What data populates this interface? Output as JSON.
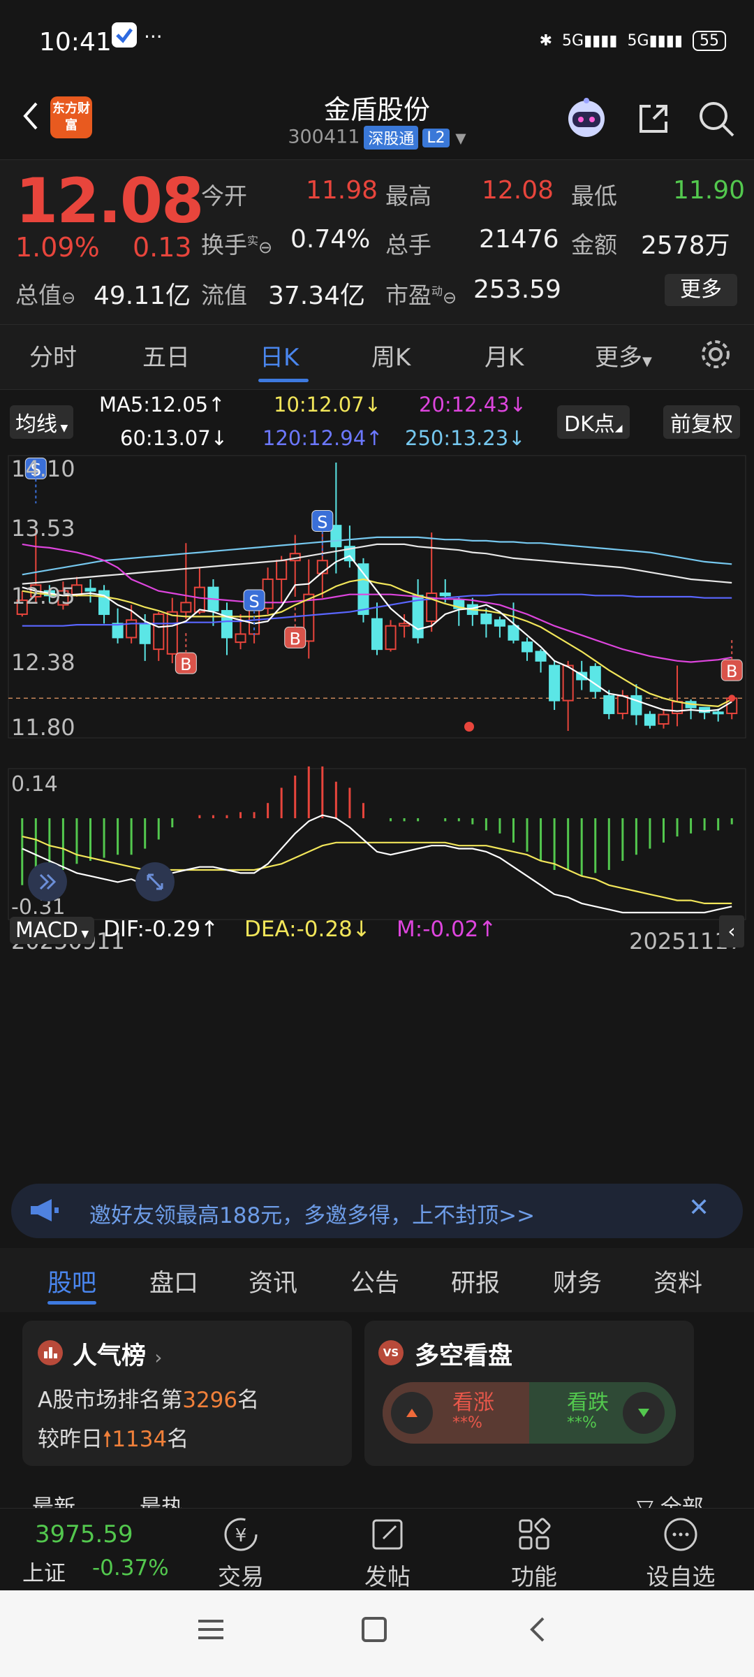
{
  "status": {
    "time": "10:41",
    "signal1": "5G",
    "signal2": "5G",
    "battery": "55",
    "more": "···"
  },
  "header": {
    "name": "金盾股份",
    "code": "300411",
    "tag1": "深股通",
    "tag2": "L2",
    "logo": "东方财富"
  },
  "quote": {
    "price": "12.08",
    "change_pct": "1.09%",
    "change": "0.13",
    "open_label": "今开",
    "open": "11.98",
    "high_label": "最高",
    "high": "12.08",
    "low_label": "最低",
    "low": "11.90",
    "turnover_label": "换手",
    "turnover_sup": "实",
    "turnover": "0.74%",
    "volume_label": "总手",
    "volume": "21476",
    "amount_label": "金额",
    "amount": "2578万",
    "mcap_label": "总值",
    "mcap": "49.11亿",
    "float_label": "流值",
    "float_mcap": "37.34亿",
    "pe_label": "市盈",
    "pe_sup": "动",
    "pe": "253.59",
    "more": "更多"
  },
  "tabs": [
    "分时",
    "五日",
    "日K",
    "周K",
    "月K",
    "更多"
  ],
  "active_tab": "日K",
  "ma": {
    "selector": "均线",
    "ma5": "MA5:12.05",
    "ma10": "10:12.07",
    "ma20": "20:12.43",
    "ma60": "60:13.07",
    "ma120": "120:12.94",
    "ma250": "250:13.23",
    "dk": "DK点",
    "adjust": "前复权",
    "colors": {
      "ma5": "#ffffff",
      "ma10": "#f2e65a",
      "ma20": "#de45de",
      "ma60": "#ffffff",
      "ma120": "#6c78ff",
      "ma250": "#76c8ef"
    }
  },
  "macd": {
    "selector": "MACD",
    "dif": "DIF:-0.29",
    "dea": "DEA:-0.28",
    "m": "M:-0.02",
    "top": "0.14",
    "bottom": "-0.31"
  },
  "chart_data": {
    "type": "candlestick",
    "y_ticks": [
      "14.10",
      "13.53",
      "12.95",
      "12.38",
      "11.80"
    ],
    "ylim": [
      11.8,
      14.1
    ],
    "x_start": "20250911",
    "x_end": "20251117",
    "candles": [
      [
        12.8,
        12.92,
        13.0,
        12.78
      ],
      [
        12.95,
        13.05,
        13.52,
        12.9
      ],
      [
        13.0,
        12.96,
        13.05,
        12.9
      ],
      [
        12.88,
        13.0,
        13.08,
        12.84
      ],
      [
        12.97,
        13.05,
        13.12,
        12.95
      ],
      [
        13.02,
        13.0,
        13.1,
        12.9
      ],
      [
        13.0,
        12.8,
        13.05,
        12.72
      ],
      [
        12.72,
        12.6,
        12.85,
        12.55
      ],
      [
        12.6,
        12.75,
        12.88,
        12.55
      ],
      [
        12.72,
        12.55,
        12.8,
        12.4
      ],
      [
        12.5,
        12.8,
        12.82,
        12.4
      ],
      [
        12.46,
        12.82,
        12.94,
        12.38
      ],
      [
        12.82,
        12.9,
        13.41,
        12.76
      ],
      [
        12.82,
        13.03,
        13.2,
        12.8
      ],
      [
        13.03,
        12.83,
        13.1,
        12.7
      ],
      [
        12.83,
        12.6,
        12.9,
        12.45
      ],
      [
        12.56,
        12.63,
        12.8,
        12.5
      ],
      [
        12.63,
        12.85,
        12.9,
        12.55
      ],
      [
        12.85,
        13.1,
        13.2,
        12.8
      ],
      [
        13.1,
        13.26,
        13.3,
        12.9
      ],
      [
        13.26,
        13.32,
        13.48,
        12.95
      ],
      [
        12.57,
        12.97,
        13.27,
        12.42
      ],
      [
        13.15,
        13.26,
        13.6,
        12.94
      ],
      [
        13.56,
        13.38,
        14.1,
        13.15
      ],
      [
        13.38,
        13.26,
        13.56,
        13.2
      ],
      [
        13.23,
        12.8,
        13.28,
        12.73
      ],
      [
        12.76,
        12.5,
        12.9,
        12.45
      ],
      [
        12.5,
        12.7,
        12.75,
        12.48
      ],
      [
        12.7,
        12.72,
        12.8,
        12.6
      ],
      [
        12.96,
        12.6,
        13.1,
        12.55
      ],
      [
        12.74,
        12.98,
        13.5,
        12.65
      ],
      [
        12.98,
        12.96,
        13.1,
        12.9
      ],
      [
        12.92,
        12.85,
        12.95,
        12.7
      ],
      [
        12.88,
        12.8,
        12.94,
        12.7
      ],
      [
        12.8,
        12.72,
        12.85,
        12.6
      ],
      [
        12.75,
        12.7,
        12.78,
        12.6
      ],
      [
        12.7,
        12.58,
        12.9,
        12.55
      ],
      [
        12.56,
        12.48,
        12.6,
        12.4
      ],
      [
        12.48,
        12.4,
        12.5,
        12.3
      ],
      [
        12.36,
        12.06,
        12.4,
        11.98
      ],
      [
        12.06,
        12.36,
        12.4,
        11.8
      ],
      [
        12.3,
        12.24,
        12.4,
        12.15
      ],
      [
        12.35,
        12.14,
        12.38,
        12.08
      ],
      [
        12.1,
        11.95,
        12.15,
        11.9
      ],
      [
        11.95,
        12.1,
        12.15,
        11.9
      ],
      [
        12.1,
        11.94,
        12.2,
        11.85
      ],
      [
        11.94,
        11.85,
        11.97,
        11.82
      ],
      [
        11.86,
        11.94,
        11.99,
        11.82
      ],
      [
        11.95,
        12.05,
        12.36,
        11.84
      ],
      [
        12.05,
        12.0,
        12.07,
        11.9
      ],
      [
        12.0,
        11.96,
        12.0,
        11.9
      ],
      [
        11.96,
        11.95,
        11.99,
        11.88
      ],
      [
        11.95,
        12.08,
        12.08,
        11.9
      ]
    ],
    "ma5": [
      13.03,
      13.0,
      12.98,
      12.96,
      12.97,
      12.98,
      12.96,
      12.88,
      12.83,
      12.74,
      12.69,
      12.7,
      12.74,
      12.84,
      12.82,
      12.78,
      12.75,
      12.72,
      12.74,
      12.87,
      13.05,
      13.06,
      13.16,
      13.25,
      13.3,
      13.15,
      13.0,
      12.85,
      12.75,
      12.67,
      12.7,
      12.8,
      12.84,
      12.85,
      12.88,
      12.82,
      12.72,
      12.62,
      12.52,
      12.4,
      12.35,
      12.28,
      12.2,
      12.12,
      12.1,
      12.06,
      12.02,
      11.98,
      11.97,
      11.98,
      11.97,
      11.98,
      12.05
    ],
    "ma10": [
      13.0,
      12.98,
      12.97,
      12.96,
      12.96,
      12.96,
      12.95,
      12.93,
      12.9,
      12.86,
      12.83,
      12.79,
      12.78,
      12.78,
      12.78,
      12.78,
      12.78,
      12.78,
      12.79,
      12.82,
      12.88,
      12.93,
      12.98,
      13.04,
      13.08,
      13.1,
      13.07,
      13.05,
      13.0,
      12.96,
      12.93,
      12.89,
      12.86,
      12.84,
      12.83,
      12.81,
      12.78,
      12.74,
      12.69,
      12.62,
      12.55,
      12.48,
      12.4,
      12.32,
      12.25,
      12.18,
      12.12,
      12.08,
      12.05,
      12.03,
      12.02,
      12.01,
      12.07
    ],
    "ma20": [
      13.4,
      13.38,
      13.37,
      13.35,
      13.33,
      13.3,
      13.26,
      13.2,
      13.1,
      13.05,
      13.0,
      12.98,
      12.96,
      12.94,
      12.93,
      12.92,
      12.91,
      12.9,
      12.9,
      12.9,
      12.91,
      12.92,
      12.93,
      12.95,
      12.97,
      12.97,
      12.97,
      12.97,
      12.96,
      12.95,
      12.94,
      12.93,
      12.93,
      12.92,
      12.9,
      12.88,
      12.84,
      12.8,
      12.75,
      12.7,
      12.66,
      12.62,
      12.58,
      12.54,
      12.5,
      12.47,
      12.44,
      12.42,
      12.4,
      12.39,
      12.4,
      12.41,
      12.43
    ],
    "ma60": [
      13.06,
      13.07,
      13.08,
      13.1,
      13.11,
      13.12,
      13.13,
      13.14,
      13.15,
      13.16,
      13.17,
      13.18,
      13.19,
      13.2,
      13.21,
      13.22,
      13.23,
      13.24,
      13.25,
      13.26,
      13.28,
      13.3,
      13.32,
      13.34,
      13.36,
      13.38,
      13.4,
      13.4,
      13.4,
      13.38,
      13.37,
      13.36,
      13.35,
      13.33,
      13.32,
      13.3,
      13.28,
      13.27,
      13.26,
      13.25,
      13.24,
      13.23,
      13.22,
      13.21,
      13.2,
      13.18,
      13.16,
      13.14,
      13.12,
      13.1,
      13.09,
      13.08,
      13.07
    ],
    "ma120": [
      12.7,
      12.7,
      12.7,
      12.7,
      12.71,
      12.71,
      12.71,
      12.71,
      12.72,
      12.72,
      12.72,
      12.72,
      12.73,
      12.73,
      12.73,
      12.74,
      12.74,
      12.75,
      12.76,
      12.77,
      12.78,
      12.79,
      12.8,
      12.81,
      12.82,
      12.84,
      12.86,
      12.88,
      12.9,
      12.92,
      12.93,
      12.94,
      12.95,
      12.96,
      12.96,
      12.97,
      12.97,
      12.97,
      12.97,
      12.97,
      12.97,
      12.97,
      12.96,
      12.96,
      12.96,
      12.95,
      12.95,
      12.95,
      12.95,
      12.95,
      12.94,
      12.94,
      12.94
    ],
    "ma250": [
      13.14,
      13.16,
      13.18,
      13.2,
      13.22,
      13.24,
      13.26,
      13.27,
      13.28,
      13.29,
      13.3,
      13.31,
      13.32,
      13.33,
      13.34,
      13.35,
      13.36,
      13.37,
      13.38,
      13.39,
      13.4,
      13.41,
      13.42,
      13.43,
      13.44,
      13.45,
      13.46,
      13.46,
      13.46,
      13.46,
      13.45,
      13.44,
      13.44,
      13.43,
      13.43,
      13.42,
      13.42,
      13.41,
      13.41,
      13.4,
      13.39,
      13.38,
      13.37,
      13.36,
      13.35,
      13.34,
      13.33,
      13.31,
      13.29,
      13.27,
      13.25,
      13.24,
      13.23
    ],
    "markers": [
      {
        "label": "S",
        "index": 1,
        "price": 14.05
      },
      {
        "label": "B",
        "index": 12,
        "price": 12.38
      },
      {
        "label": "S",
        "index": 17,
        "price": 12.92
      },
      {
        "label": "B",
        "index": 20,
        "price": 12.6
      },
      {
        "label": "S",
        "index": 22,
        "price": 13.6
      },
      {
        "label": "B",
        "index": 52,
        "price": 12.32
      }
    ],
    "last_price": 12.08,
    "macd_hist": [
      -0.22,
      -0.22,
      -0.2,
      -0.17,
      -0.15,
      -0.14,
      -0.13,
      -0.12,
      -0.12,
      -0.1,
      -0.07,
      -0.03,
      0.0,
      0.01,
      0.01,
      0.01,
      0.02,
      0.02,
      0.05,
      0.1,
      0.14,
      0.17,
      0.17,
      0.12,
      0.1,
      0.05,
      0.0,
      -0.01,
      -0.01,
      -0.01,
      0.0,
      -0.01,
      -0.01,
      -0.02,
      -0.04,
      -0.05,
      -0.08,
      -0.11,
      -0.14,
      -0.17,
      -0.17,
      -0.19,
      -0.18,
      -0.17,
      -0.14,
      -0.12,
      -0.1,
      -0.08,
      -0.06,
      -0.05,
      -0.04,
      -0.04,
      -0.02
    ],
    "dif": [
      -0.1,
      -0.12,
      -0.14,
      -0.16,
      -0.18,
      -0.19,
      -0.2,
      -0.21,
      -0.2,
      -0.22,
      -0.2,
      -0.18,
      -0.17,
      -0.16,
      -0.16,
      -0.17,
      -0.18,
      -0.18,
      -0.15,
      -0.1,
      -0.05,
      -0.01,
      0.01,
      0.0,
      -0.03,
      -0.07,
      -0.11,
      -0.12,
      -0.11,
      -0.1,
      -0.09,
      -0.09,
      -0.1,
      -0.1,
      -0.11,
      -0.13,
      -0.16,
      -0.19,
      -0.22,
      -0.25,
      -0.26,
      -0.28,
      -0.29,
      -0.3,
      -0.31,
      -0.31,
      -0.31,
      -0.31,
      -0.31,
      -0.31,
      -0.31,
      -0.3,
      -0.29
    ],
    "dea": [
      -0.06,
      -0.07,
      -0.09,
      -0.1,
      -0.12,
      -0.13,
      -0.14,
      -0.15,
      -0.16,
      -0.17,
      -0.17,
      -0.17,
      -0.17,
      -0.17,
      -0.17,
      -0.17,
      -0.17,
      -0.17,
      -0.16,
      -0.15,
      -0.13,
      -0.11,
      -0.09,
      -0.08,
      -0.08,
      -0.08,
      -0.08,
      -0.08,
      -0.08,
      -0.08,
      -0.08,
      -0.08,
      -0.09,
      -0.09,
      -0.09,
      -0.1,
      -0.11,
      -0.12,
      -0.14,
      -0.15,
      -0.17,
      -0.19,
      -0.2,
      -0.22,
      -0.23,
      -0.24,
      -0.25,
      -0.26,
      -0.27,
      -0.27,
      -0.28,
      -0.28,
      -0.28
    ]
  },
  "banner": {
    "text": "邀好友领最高188元，多邀多得，上不封顶>>"
  },
  "content_tabs": [
    "股吧",
    "盘口",
    "资讯",
    "公告",
    "研报",
    "财务",
    "资料"
  ],
  "card1": {
    "title": "人气榜",
    "line1_prefix": "A股市场排名第",
    "rank": "3296",
    "line1_suffix": "名",
    "line2_prefix": "较昨日",
    "rank_change": "1134",
    "line2_suffix": "名"
  },
  "card2": {
    "title": "多空看盘",
    "up": "看涨",
    "up_pct": "**%",
    "down": "看跌",
    "down_pct": "**%"
  },
  "partial_tabs": {
    "latest": "最新",
    "hot": "最热",
    "all": "全部"
  },
  "index": {
    "value": "3975.59",
    "name": "上证",
    "change": "-0.37%"
  },
  "bottom_nav": [
    "交易",
    "发帖",
    "功能",
    "设自选"
  ]
}
